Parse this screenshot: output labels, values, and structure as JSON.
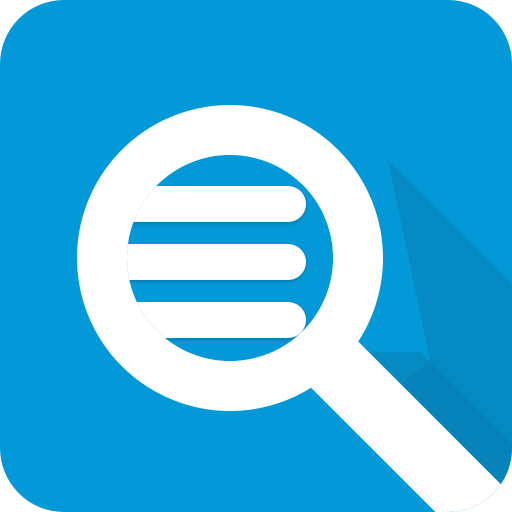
{
  "app_icon": {
    "icon": "search-list-icon",
    "colors": {
      "background": "#0399D8",
      "shadow": "#0A7DB4",
      "foreground": "#FFFFFF"
    }
  }
}
